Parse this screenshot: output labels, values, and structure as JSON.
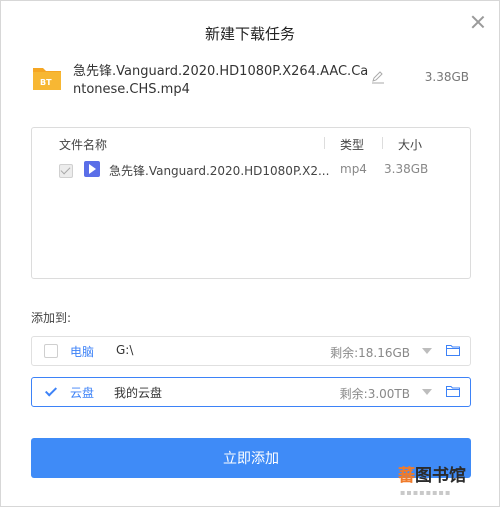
{
  "dialog": {
    "title": "新建下载任务"
  },
  "file": {
    "name": "急先锋.Vanguard.2020.HD1080P.X264.AAC.Cantonese.CHS.mp4",
    "total_size": "3.38GB",
    "badge": "BT"
  },
  "table": {
    "headers": {
      "name": "文件名称",
      "type": "类型",
      "size": "大小"
    },
    "rows": [
      {
        "name": "急先锋.Vanguard.2020.HD1080P.X2...",
        "type": "mp4",
        "size": "3.38GB"
      }
    ]
  },
  "add_to": {
    "label": "添加到:"
  },
  "destinations": [
    {
      "type": "电脑",
      "path": "G:\\",
      "remaining": "剩余:18.16GB",
      "checked": false
    },
    {
      "type": "云盘",
      "path": "我的云盘",
      "remaining": "剩余:3.00TB",
      "checked": true
    }
  ],
  "confirm_button": "立即添加",
  "watermark": {
    "text_a": "蕃",
    "text_b": "图书馆"
  },
  "colors": {
    "accent": "#3f8bf7",
    "folder": "#f5a623",
    "video_icon": "#5a6ee8"
  }
}
